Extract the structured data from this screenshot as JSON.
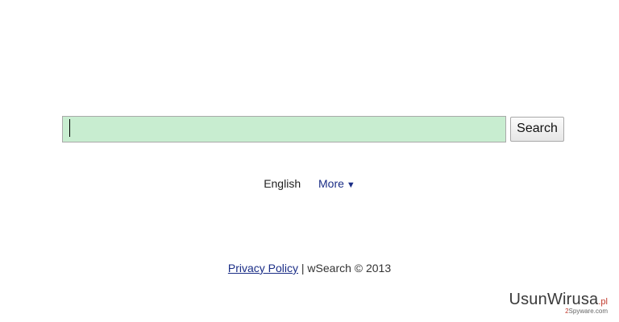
{
  "search": {
    "value": "",
    "button_label": "Search"
  },
  "language": {
    "current": "English",
    "more_label": "More",
    "more_arrow": "▼"
  },
  "footer": {
    "privacy_link": "Privacy Policy",
    "separator": "|",
    "copyright": "wSearch © 2013"
  },
  "watermark": {
    "name": "UsunWirusa",
    "tld": ".pl",
    "sub_prefix": "2",
    "sub_text": "Spyware.com"
  },
  "colors": {
    "input_background": "#c8edd0",
    "link": "#1a2d86",
    "watermark_accent": "#c0392b"
  }
}
